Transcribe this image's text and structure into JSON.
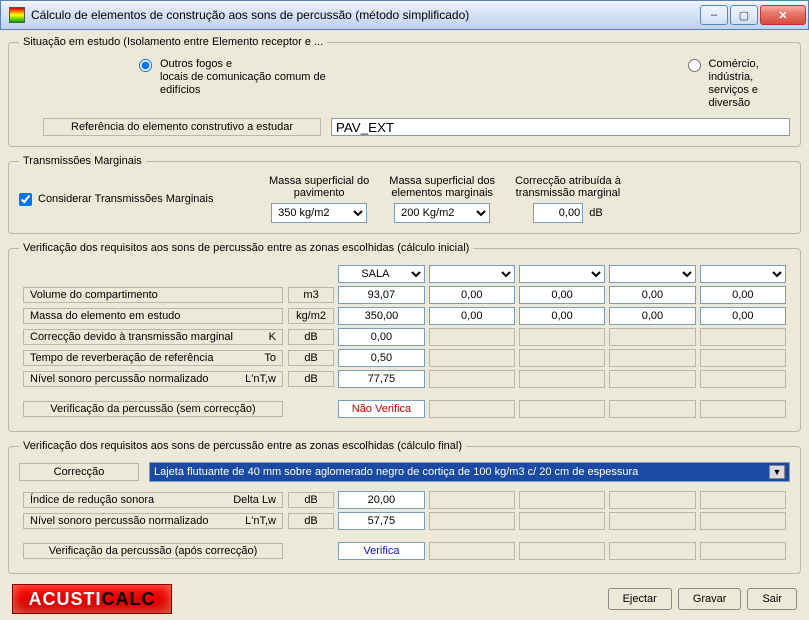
{
  "window": {
    "title": "Cálculo de elementos de construção aos sons de percussão (método simplificado)"
  },
  "situacao": {
    "legend": "Situação em estudo (Isolamento entre Elemento receptor e ...",
    "radio1": "Outros fogos e\nlocais de comunicação comum de edifícios",
    "radio2": "Comércio, indústria,\nserviços e diversão",
    "ref_label": "Referência do elemento construtivo a estudar",
    "ref_value": "PAV_EXT"
  },
  "tm": {
    "legend": "Transmissões Marginais",
    "chk_label": "Considerar Transmissões Marginais",
    "box1_label": "Massa superficial do\npavimento",
    "box1_value": "350 kg/m2",
    "box2_label": "Massa superficial dos\nelementos marginais",
    "box2_value": "200 Kg/m2",
    "box3_label": "Correcção atribuída à\ntransmissão marginal",
    "box3_value": "0,00",
    "box3_unit": "dB"
  },
  "table1": {
    "legend": "Verificação dos requisitos aos sons de percussão entre as zonas escolhidas (cálculo inicial)",
    "col1": "SALA",
    "rows": [
      {
        "label": "Volume do compartimento",
        "suffix": "",
        "unit": "m3",
        "v": [
          "93,07",
          "0,00",
          "0,00",
          "0,00",
          "0,00"
        ]
      },
      {
        "label": "Massa do elemento em estudo",
        "suffix": "",
        "unit": "kg/m2",
        "v": [
          "350,00",
          "0,00",
          "0,00",
          "0,00",
          "0,00"
        ]
      },
      {
        "label": "Correcção devido à transmissão marginal",
        "suffix": "K",
        "unit": "dB",
        "v": [
          "0,00",
          "",
          "",
          "",
          ""
        ]
      },
      {
        "label": "Tempo de reverberação de referência",
        "suffix": "To",
        "unit": "dB",
        "v": [
          "0,50",
          "",
          "",
          "",
          ""
        ]
      },
      {
        "label": "Nível sonoro percussão normalizado",
        "suffix": "L'nT,w",
        "unit": "dB",
        "v": [
          "77,75",
          "",
          "",
          "",
          ""
        ]
      }
    ],
    "verify_label": "Verificação da percussão (sem correcção)",
    "verify_values": [
      "Não Verifica",
      "",
      "",
      "",
      ""
    ]
  },
  "table2": {
    "legend": "Verificação dos requisitos aos sons de percussão entre as zonas escolhidas (cálculo final)",
    "corr_label": "Correcção",
    "corr_value": "Lajeta flutuante de 40 mm sobre aglomerado negro de cortiça de 100 kg/m3 c/ 20 cm de espessura",
    "rows": [
      {
        "label": "Índice de redução sonora",
        "suffix": "Delta Lw",
        "unit": "dB",
        "v": [
          "20,00",
          "",
          "",
          "",
          ""
        ]
      },
      {
        "label": "Nível sonoro percussão normalizado",
        "suffix": "L'nT,w",
        "unit": "dB",
        "v": [
          "57,75",
          "",
          "",
          "",
          ""
        ]
      }
    ],
    "verify_label": "Verificação da percussão (após correcção)",
    "verify_values": [
      "Verifica",
      "",
      "",
      "",
      ""
    ]
  },
  "footer": {
    "logo1": "ACUSTI",
    "logo2": "CALC",
    "btn_eject": "Ejectar",
    "btn_save": "Gravar",
    "btn_exit": "Sair"
  }
}
